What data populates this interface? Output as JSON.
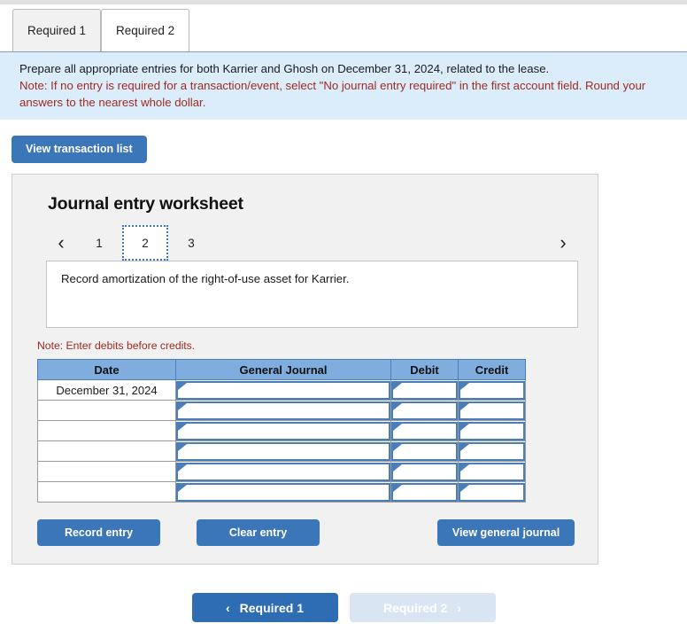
{
  "tabs": [
    {
      "label": "Required 1",
      "active": false
    },
    {
      "label": "Required 2",
      "active": true
    }
  ],
  "instructions": {
    "line1": "Prepare all appropriate entries for both Karrier and Ghosh on December 31, 2024, related to the lease.",
    "line2": "Note: If no entry is required for a transaction/event, select \"No journal entry required\" in the first account field. Round your answers to the nearest whole dollar."
  },
  "toolbar": {
    "view_transaction_list_label": "View transaction list"
  },
  "worksheet": {
    "title": "Journal entry worksheet",
    "pager": {
      "prev_icon": "‹",
      "next_icon": "›",
      "pages": [
        "1",
        "2",
        "3"
      ],
      "selected": "2"
    },
    "description": "Record amortization of the right-of-use asset for Karrier.",
    "debit_note": "Note: Enter debits before credits.",
    "table": {
      "columns": [
        "Date",
        "General Journal",
        "Debit",
        "Credit"
      ],
      "rows": [
        {
          "date": "December 31, 2024",
          "general_journal": "",
          "debit": "",
          "credit": ""
        },
        {
          "date": "",
          "general_journal": "",
          "debit": "",
          "credit": ""
        },
        {
          "date": "",
          "general_journal": "",
          "debit": "",
          "credit": ""
        },
        {
          "date": "",
          "general_journal": "",
          "debit": "",
          "credit": ""
        },
        {
          "date": "",
          "general_journal": "",
          "debit": "",
          "credit": ""
        },
        {
          "date": "",
          "general_journal": "",
          "debit": "",
          "credit": ""
        }
      ]
    },
    "buttons": {
      "record_entry": "Record entry",
      "clear_entry": "Clear entry",
      "view_general_journal": "View general journal"
    }
  },
  "bottom_nav": {
    "prev_label": "Required 1",
    "prev_chevron": "‹",
    "next_label": "Required 2",
    "next_chevron": "›"
  },
  "colors": {
    "accent_blue": "#3b76b8",
    "nav_blue": "#2e6db4",
    "nav_disabled": "#d9e5f2",
    "table_header": "#7fadde",
    "info_panel": "#dbedfa",
    "note_red": "#9e2a20",
    "panel_bg": "#f1f1f1"
  }
}
